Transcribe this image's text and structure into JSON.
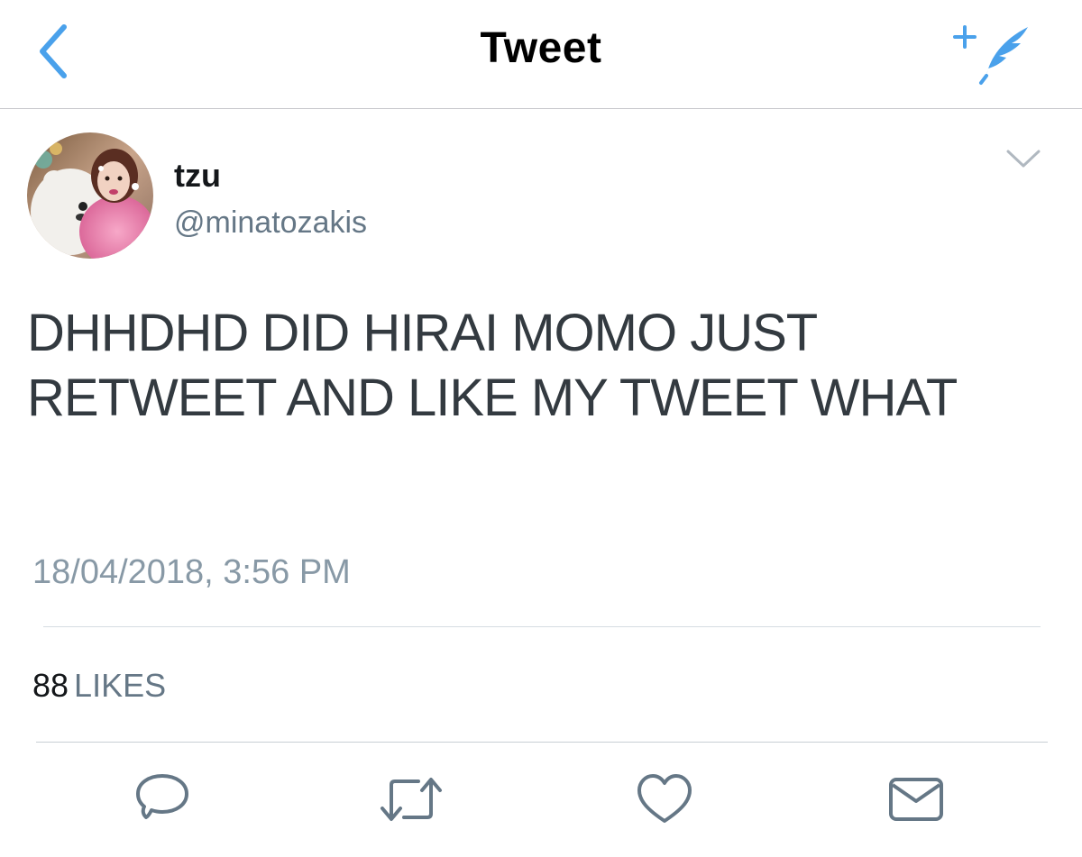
{
  "nav": {
    "title": "Tweet",
    "back_icon": "chevron-left-icon",
    "compose_icon": "compose-tweet-icon",
    "accent_color": "#4aa1eb"
  },
  "author": {
    "display_name": "tzu",
    "handle": "@minatozakis"
  },
  "tweet": {
    "text": "DHHDHD DID HIRAI MOMO JUST RETWEET AND LIKE MY TWEET WHAT",
    "timestamp": "18/04/2018, 3:56 PM"
  },
  "stats": {
    "likes_count": "88",
    "likes_label": "LIKES"
  },
  "actions": [
    {
      "name": "reply",
      "icon": "reply-icon"
    },
    {
      "name": "retweet",
      "icon": "retweet-icon"
    },
    {
      "name": "like",
      "icon": "heart-icon"
    },
    {
      "name": "direct-message",
      "icon": "envelope-icon"
    }
  ],
  "colors": {
    "secondary_text": "#657786",
    "icon_gray": "#657786"
  }
}
